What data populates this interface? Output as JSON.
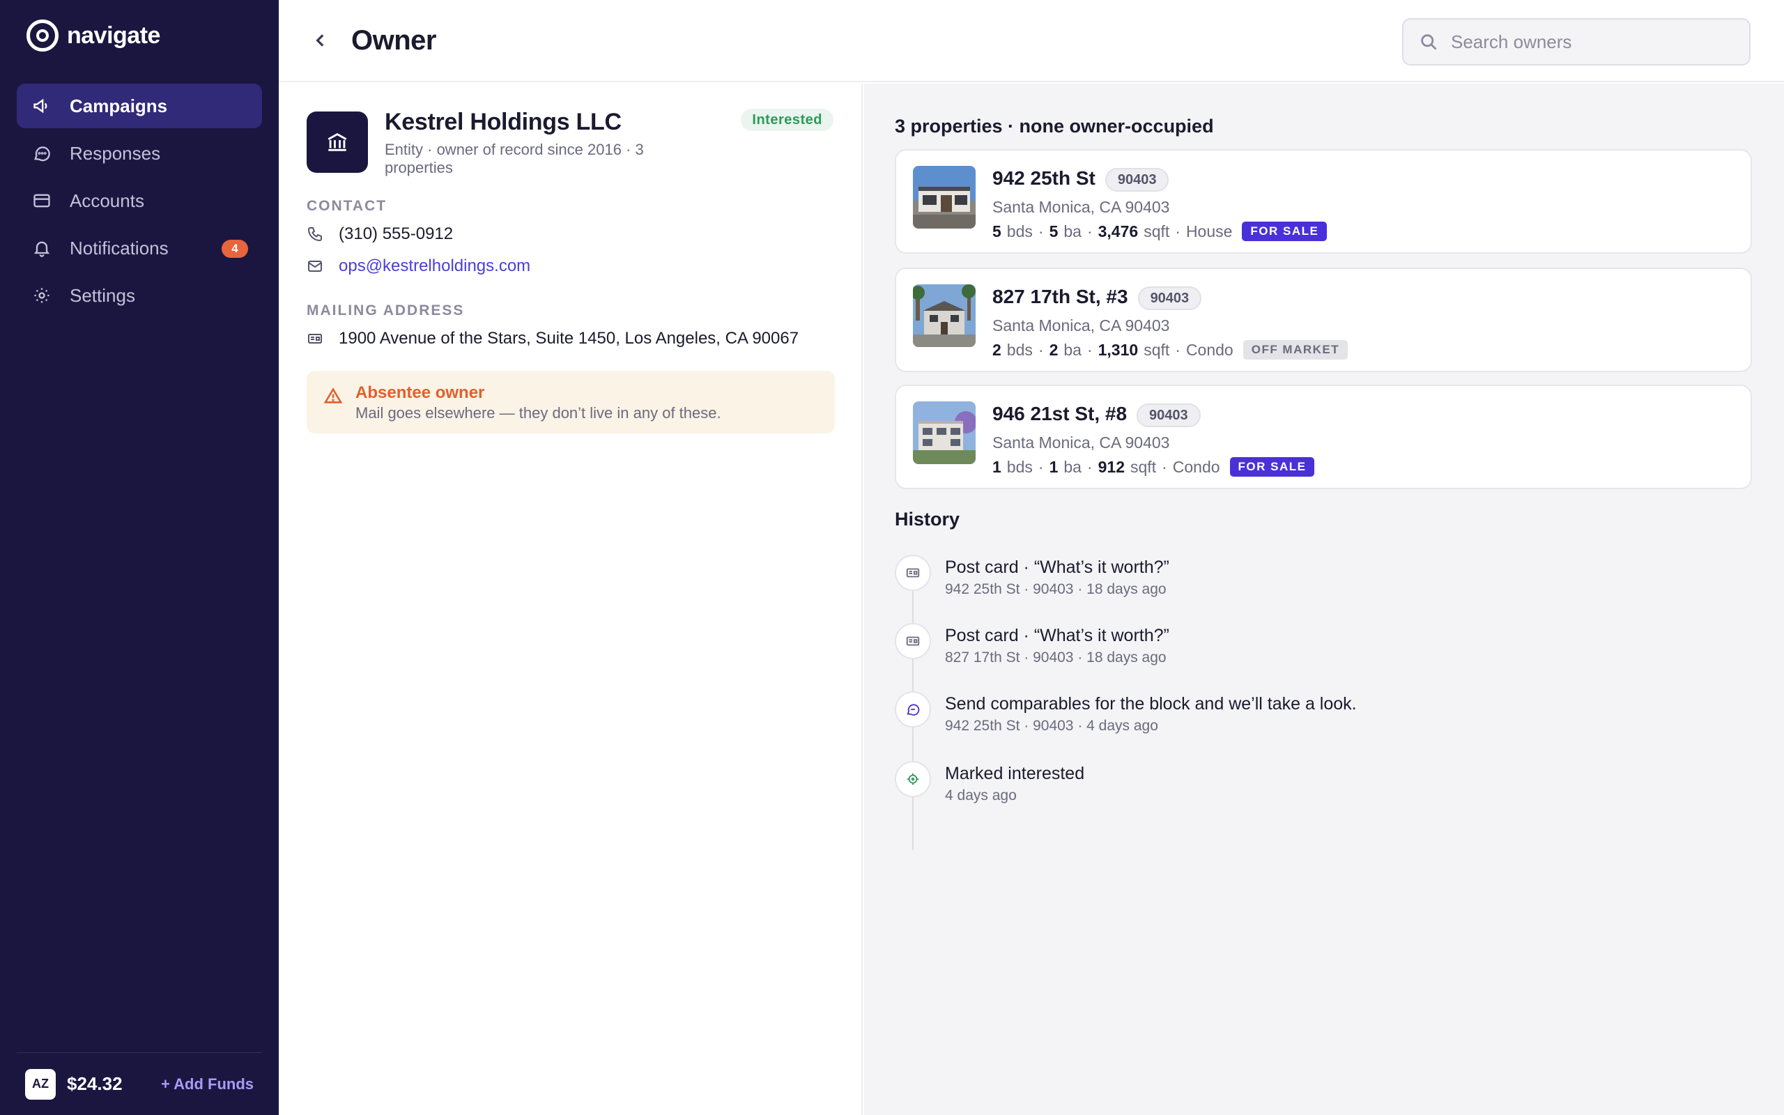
{
  "app": {
    "name": "navigate"
  },
  "sidebar": {
    "items": [
      {
        "label": "Campaigns",
        "icon": "megaphone-icon",
        "active": true
      },
      {
        "label": "Responses",
        "icon": "chat-bubble-icon"
      },
      {
        "label": "Accounts",
        "icon": "credit-card-icon"
      },
      {
        "label": "Notifications",
        "icon": "bell-icon",
        "badge": "4"
      },
      {
        "label": "Settings",
        "icon": "gear-icon"
      }
    ],
    "footer": {
      "avatar": "AZ",
      "balance": "$24.32",
      "add_funds": "+ Add Funds"
    }
  },
  "header": {
    "title": "Owner",
    "search_placeholder": "Search owners"
  },
  "owner": {
    "name": "Kestrel Holdings LLC",
    "subtitle": "Entity · owner of record since 2016 · 3 properties",
    "status": "Interested",
    "contact_label": "CONTACT",
    "phone": "(310) 555-0912",
    "email": "ops@kestrelholdings.com",
    "mailing_label": "MAILING ADDRESS",
    "mailing_address": "1900 Avenue of the Stars, Suite 1450, Los Angeles, CA 90067",
    "alert_title": "Absentee owner",
    "alert_text": "Mail goes elsewhere — they don’t live in any of these."
  },
  "properties": {
    "heading": "3 properties · none owner-occupied",
    "items": [
      {
        "address": "942 25th St",
        "zip": "90403",
        "city": "Santa Monica, CA 90403",
        "beds": "5",
        "baths": "5",
        "sqft": "3,476",
        "type": "House",
        "tag": "FOR SALE"
      },
      {
        "address": "827 17th St, #3",
        "zip": "90403",
        "city": "Santa Monica, CA 90403",
        "beds": "2",
        "baths": "2",
        "sqft": "1,310",
        "type": "Condo",
        "tag": "OFF MARKET"
      },
      {
        "address": "946 21st St, #8",
        "zip": "90403",
        "city": "Santa Monica, CA 90403",
        "beds": "1",
        "baths": "1",
        "sqft": "912",
        "type": "Condo",
        "tag": "FOR SALE"
      }
    ],
    "units": {
      "beds": "bds",
      "baths": "ba",
      "sqft": "sqft"
    }
  },
  "history": {
    "heading": "History",
    "items": [
      {
        "icon": "postcard-icon",
        "title": "Post card · “What’s it worth?”",
        "meta": "942 25th St · 90403 · 18 days ago"
      },
      {
        "icon": "postcard-icon",
        "title": "Post card · “What’s it worth?”",
        "meta": "827 17th St · 90403 · 18 days ago"
      },
      {
        "icon": "chat-bubble-icon",
        "title": "Send comparables for the block and we’ll take a look.",
        "meta": "942 25th St · 90403 · 4 days ago"
      },
      {
        "icon": "target-icon",
        "title": "Marked interested",
        "meta": "4 days ago"
      }
    ]
  },
  "colors": {
    "sidebar_bg": "#1b1640",
    "accent": "#4a30d8",
    "badge": "#e8643a",
    "interested": "#2c9a5a",
    "alert": "#e0612b"
  }
}
